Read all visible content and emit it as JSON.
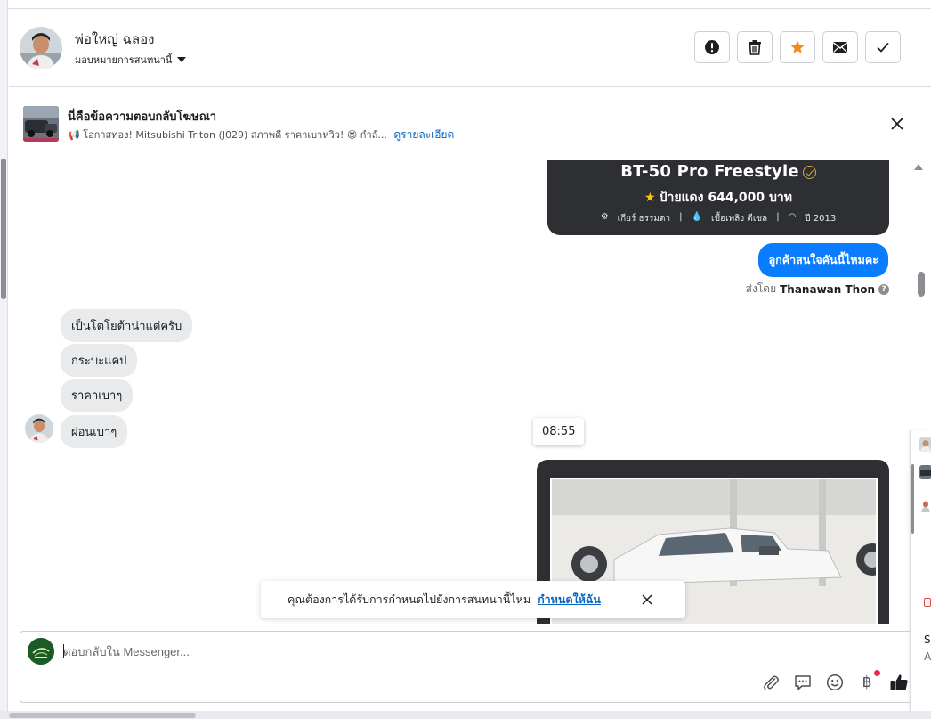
{
  "header": {
    "name": "พ่อใหญ่ ฉลอง",
    "assign_label": "มอบหมายการสนทนานี้",
    "actions": [
      {
        "icon": "exclamation-icon",
        "label": "Mark as spam"
      },
      {
        "icon": "trash-icon",
        "label": "Delete"
      },
      {
        "icon": "star-icon",
        "label": "Star",
        "color": "#f08c1a"
      },
      {
        "icon": "envelope-icon",
        "label": "Mark as unread"
      },
      {
        "icon": "checkmark-icon",
        "label": "Mark as done"
      }
    ]
  },
  "ad_reply": {
    "title": "นี่คือข้อความตอบกลับโฆษณา",
    "text": "📢 โอกาสทอง! Mitsubishi Triton (J029) สภาพดี ราคาเบาหวิว! 😍 กำลั...",
    "link": "ดูรายละเอียด"
  },
  "car_card": {
    "title": "BT-50 Pro Freestyle",
    "price": "ป้ายแดง 644,000 บาท",
    "specs": [
      "เกียร์ ธรรมดา",
      "เชื้อเพลิง ดีเซล",
      "ปี 2013"
    ]
  },
  "messages": {
    "outgoing": "ลูกค้าสนใจคันนี้ไหมคะ",
    "sent_by_prefix": "ส่งโดย",
    "sent_by_name": "Thanawan Thon",
    "incoming": [
      "เป็นโตโยต้าน่าแต่ครับ",
      "กระบะแคป",
      "ราคาเบาๆ",
      "ผ่อนเบาๆ"
    ],
    "time_chip": "08:55"
  },
  "toast": {
    "text": "คุณต้องการได้รับการกำหนดไปยังการสนทนานี้ไหม",
    "link": "กำหนดให้ฉัน"
  },
  "composer": {
    "placeholder": "ตอบกลับใน Messenger...",
    "tools": [
      "paperclip-icon",
      "chat-bubble-icon",
      "emoji-icon",
      "baht-icon",
      "thumbs-up-icon"
    ],
    "baht_symbol": "฿"
  },
  "side_panel": {
    "texts": [
      "S",
      "A"
    ]
  },
  "colors": {
    "accent": "#0a7cff",
    "link": "#0a66c2",
    "star": "#f08c1a",
    "card_dark": "#2d2f33"
  }
}
